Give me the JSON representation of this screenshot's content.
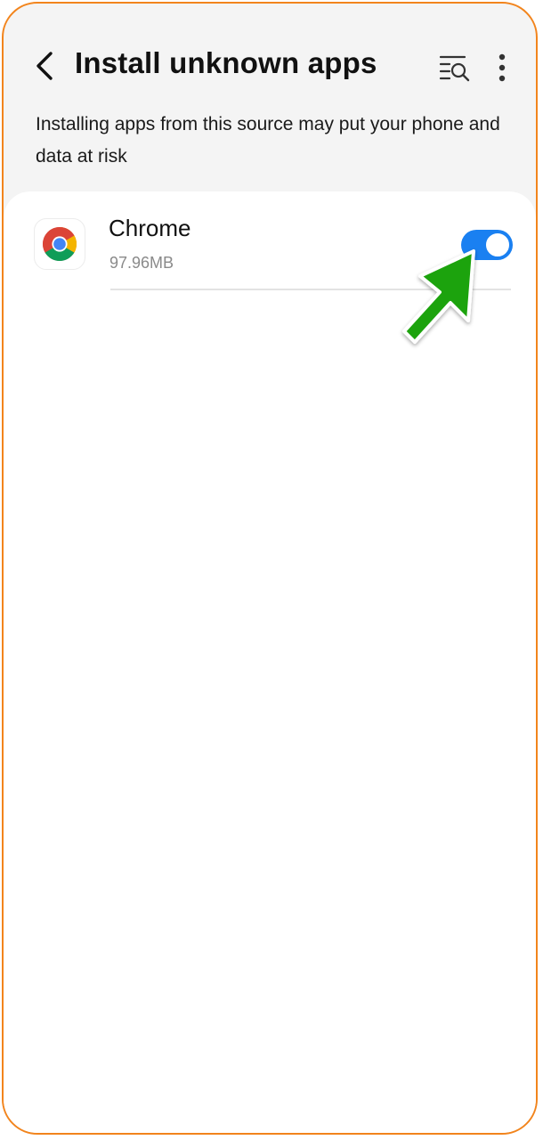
{
  "header": {
    "title": "Install unknown apps",
    "back_icon": "chevron-left-icon",
    "search_icon": "list-search-icon",
    "more_icon": "more-vertical-icon"
  },
  "warning_text": "Installing apps from this source may put your phone and data at risk",
  "apps": [
    {
      "name": "Chrome",
      "size": "97.96MB",
      "icon": "chrome-icon",
      "allowed": true
    }
  ],
  "colors": {
    "frame_border": "#f2841c",
    "toggle_on": "#1a80f1",
    "arrow_annotation": "#1fa30f",
    "page_background": "#f4f4f4"
  }
}
